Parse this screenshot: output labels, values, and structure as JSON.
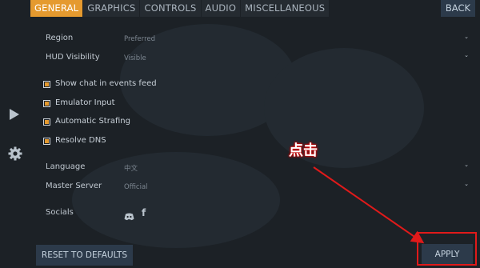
{
  "tabs": [
    {
      "label": "GENERAL",
      "active": true
    },
    {
      "label": "GRAPHICS",
      "active": false
    },
    {
      "label": "CONTROLS",
      "active": false
    },
    {
      "label": "AUDIO",
      "active": false
    },
    {
      "label": "MISCELLANEOUS",
      "active": false
    }
  ],
  "back_label": "BACK",
  "settings": {
    "region": {
      "label": "Region",
      "value": "Preferred"
    },
    "hud": {
      "label": "HUD Visibility",
      "value": "Visible"
    },
    "language": {
      "label": "Language",
      "value": "中文"
    },
    "master": {
      "label": "Master Server",
      "value": "Official"
    }
  },
  "checkboxes": [
    {
      "label": "Show chat in events feed",
      "checked": true
    },
    {
      "label": "Emulator Input",
      "checked": true
    },
    {
      "label": "Automatic Strafing",
      "checked": true
    },
    {
      "label": "Resolve DNS",
      "checked": true
    }
  ],
  "socials": {
    "label": "Socials",
    "icons": [
      "discord-icon",
      "facebook-icon"
    ]
  },
  "buttons": {
    "reset": "RESET TO DEFAULTS",
    "apply": "APPLY"
  },
  "annotation": {
    "text": "点击"
  },
  "colors": {
    "accent": "#e59a2f",
    "button_bg": "#2c3a4a",
    "annotation_red": "#e01a1a"
  }
}
